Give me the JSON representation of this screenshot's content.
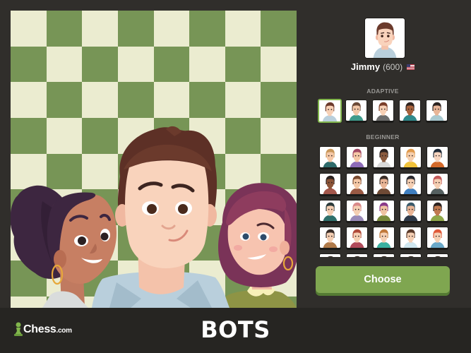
{
  "board": {
    "light_color": "#ebecd0",
    "dark_color": "#779556",
    "rows": 8,
    "cols": 8
  },
  "hero_image": {
    "characters": [
      "girl-curly-hair-avatar",
      "jimmy-avatar",
      "woman-red-hair-avatar"
    ]
  },
  "selected_bot": {
    "name": "Jimmy",
    "rating": "(600)",
    "flag": "us-flag-icon"
  },
  "sections": {
    "adaptive_label": "ADAPTIVE",
    "beginner_label": "BEGINNER"
  },
  "adaptive_bots": [
    {
      "id": "adaptive-1",
      "hair": "#6b3a2c",
      "skin": "#f7d0b5",
      "shirt": "#b9cfdc",
      "selected": true
    },
    {
      "id": "adaptive-2",
      "hair": "#6b4a38",
      "skin": "#f3c8a8",
      "shirt": "#3f9b8b",
      "selected": false
    },
    {
      "id": "adaptive-3",
      "hair": "#7a3e2a",
      "skin": "#f7d0b5",
      "shirt": "#6c6c6c",
      "selected": false
    },
    {
      "id": "adaptive-4",
      "hair": "#2f2420",
      "skin": "#a8633d",
      "shirt": "#2f8a8c",
      "selected": false
    },
    {
      "id": "adaptive-5",
      "hair": "#2b2220",
      "skin": "#e8b597",
      "shirt": "#a9c9d0",
      "selected": false
    }
  ],
  "beginner_bots": [
    {
      "id": "beginner-1",
      "hair": "#c8975a",
      "skin": "#f5c8a7",
      "shirt": "#2e6b6b"
    },
    {
      "id": "beginner-2",
      "hair": "#a34a66",
      "skin": "#f5c8a7",
      "shirt": "#8d6ab8"
    },
    {
      "id": "beginner-3",
      "hair": "#2b2220",
      "skin": "#8a5a3e",
      "shirt": "#d9d9d9"
    },
    {
      "id": "beginner-4",
      "hair": "#e09a4c",
      "skin": "#f6cfae",
      "shirt": "#f1c33c"
    },
    {
      "id": "beginner-5",
      "hair": "#1f2a38",
      "skin": "#f6d4bf",
      "shirt": "#d46a2b"
    },
    {
      "id": "beginner-6",
      "hair": "#2b2220",
      "skin": "#8c5437",
      "shirt": "#a3574b"
    },
    {
      "id": "beginner-7",
      "hair": "#7a4a30",
      "skin": "#f5c8a7",
      "shirt": "#9a5a44"
    },
    {
      "id": "beginner-8",
      "hair": "#3a2e28",
      "skin": "#e9b596",
      "shirt": "#6e4a35"
    },
    {
      "id": "beginner-9",
      "hair": "#2a2a30",
      "skin": "#f5cfb3",
      "shirt": "#3f7fc0"
    },
    {
      "id": "beginner-10",
      "hair": "#c45a5a",
      "skin": "#f5cfb3",
      "shirt": "#556060"
    },
    {
      "id": "beginner-11",
      "hair": "#2b3a3a",
      "skin": "#f5cfb3",
      "shirt": "#2e6f6a"
    },
    {
      "id": "beginner-12",
      "hair": "#d98a8a",
      "skin": "#f5cfb3",
      "shirt": "#9a8ab8"
    },
    {
      "id": "beginner-13",
      "hair": "#8a3a8a",
      "skin": "#f0c3a3",
      "shirt": "#7a8a3c"
    },
    {
      "id": "beginner-14",
      "hair": "#3a5a6a",
      "skin": "#e9b596",
      "shirt": "#2e3a4a"
    },
    {
      "id": "beginner-15",
      "hair": "#2b2220",
      "skin": "#c07a50",
      "shirt": "#8fa84a"
    },
    {
      "id": "beginner-16",
      "hair": "#3a2e28",
      "skin": "#f5cfb3",
      "shirt": "#b07a4a"
    },
    {
      "id": "beginner-17",
      "hair": "#b04a3a",
      "skin": "#f5cfb3",
      "shirt": "#b04a5a"
    },
    {
      "id": "beginner-18",
      "hair": "#c0783a",
      "skin": "#f5cfb3",
      "shirt": "#3ab0a0"
    },
    {
      "id": "beginner-19",
      "hair": "#5a3a2a",
      "skin": "#f5cfb3",
      "shirt": "#cfe6ef"
    },
    {
      "id": "beginner-20",
      "hair": "#e05a3a",
      "skin": "#f5cfb3",
      "shirt": "#6aa8c8"
    },
    {
      "id": "beginner-21",
      "hair": "#3a2e28",
      "skin": "#f5cfb3",
      "shirt": "#ffffff"
    },
    {
      "id": "beginner-22",
      "hair": "#3a2e28",
      "skin": "#f5cfb3",
      "shirt": "#ffffff"
    },
    {
      "id": "beginner-23",
      "hair": "#3a2e28",
      "skin": "#f5cfb3",
      "shirt": "#ffffff"
    },
    {
      "id": "beginner-24",
      "hair": "#3a2e28",
      "skin": "#f5cfb3",
      "shirt": "#ffffff"
    },
    {
      "id": "beginner-25",
      "hair": "#3a2e28",
      "skin": "#f5cfb3",
      "shirt": "#ffffff"
    }
  ],
  "choose_button": {
    "label": "Choose",
    "color": "#7fa650"
  },
  "footer": {
    "logo_main": "Chess",
    "logo_suffix": ".com",
    "logo_icon": "pawn-icon",
    "title": "BOTS"
  }
}
